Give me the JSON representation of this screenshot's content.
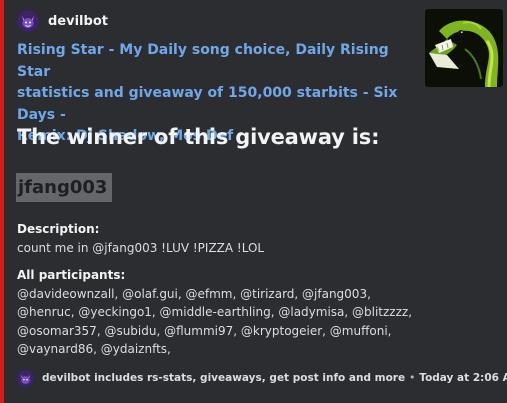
{
  "colors": {
    "accent": "#d91a1a",
    "link": "#6fa8e8",
    "background": "#2b2d31",
    "spoiler": "#64666b"
  },
  "author": {
    "name": "devilbot",
    "icon": "devil-avatar-icon"
  },
  "title": {
    "line1": "Rising Star - My Daily song choice, Daily Rising Star",
    "line2": "statistics and giveaway of 150,000 starbits  - Six Days -",
    "line3": "Remix: DJ Shadow, Mos Def"
  },
  "thumbnail": {
    "icon": "green-snake-icon"
  },
  "winner": {
    "heading": "The winner of this giveaway is:",
    "name": "jfang003"
  },
  "description": {
    "label": "Description:",
    "value": "count me in @jfang003 !LUV !PIZZA !LOL"
  },
  "participants": {
    "label": "All participants:",
    "lines": [
      "@davideownzall, @olaf.gui, @efmm, @tirizard, @jfang003,",
      "@henruc, @yeckingo1, @middle-earthling, @ladymisa, @blitzzzz,",
      "@osomar357, @subidu, @flummi97, @kryptogeier, @muffoni,",
      "@vaynard86, @ydaiznfts,"
    ]
  },
  "footer": {
    "icon": "devil-avatar-icon",
    "text": "devilbot includes rs-stats, giveaways, get post info and more",
    "separator": "•",
    "timestamp": "Today at 2:06 AM"
  }
}
